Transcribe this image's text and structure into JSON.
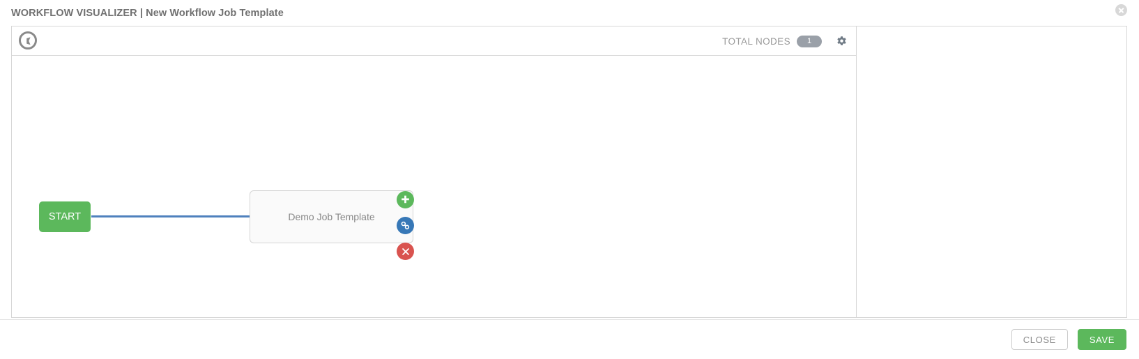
{
  "header": {
    "title": "WORKFLOW VISUALIZER | New Workflow Job Template",
    "close_icon": "close-icon"
  },
  "toolbar": {
    "compass_icon": "compass-icon",
    "total_nodes_label": "TOTAL NODES",
    "total_nodes_count": "1",
    "gear_icon": "gear-icon"
  },
  "graph": {
    "start_node": {
      "label": "START"
    },
    "nodes": [
      {
        "label": "Demo Job Template",
        "actions": [
          {
            "name": "add-node-button",
            "icon": "plus-icon",
            "color": "#5cb85c"
          },
          {
            "name": "link-node-button",
            "icon": "link-icon",
            "color": "#3778b7"
          },
          {
            "name": "delete-node-button",
            "icon": "close-icon",
            "color": "#d9534f"
          }
        ]
      }
    ],
    "edge_color": "#4f81bd"
  },
  "footer": {
    "close_label": "CLOSE",
    "save_label": "SAVE"
  },
  "colors": {
    "green": "#5cb85c",
    "blue": "#3778b7",
    "red": "#d9534f",
    "edge": "#4f81bd",
    "badge": "#9aa0a8"
  }
}
